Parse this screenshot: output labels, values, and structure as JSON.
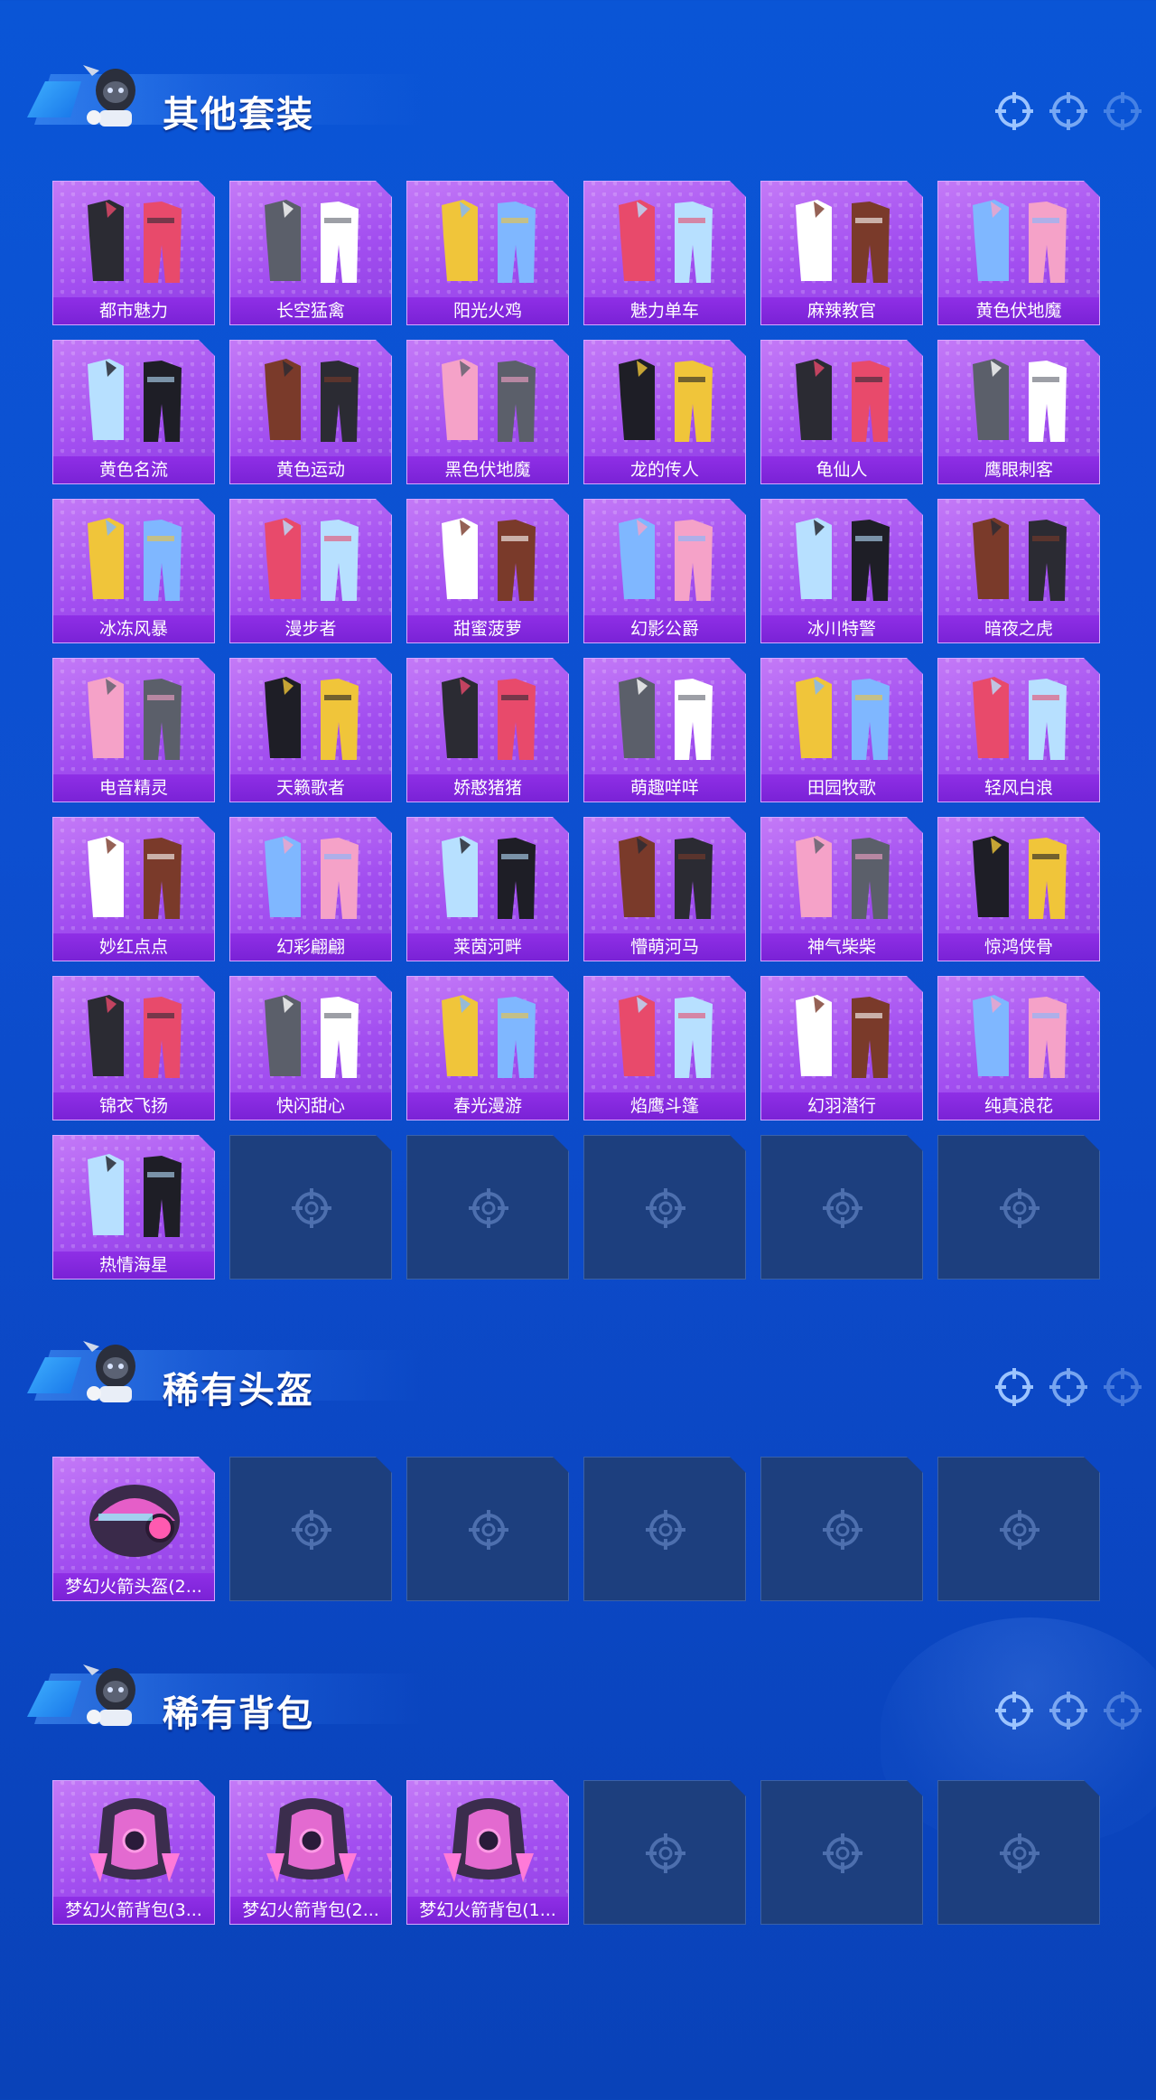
{
  "colors": {
    "bg": "#0a55d6",
    "card_purple": "#a24ef0",
    "label_purple": "#7a22d6",
    "empty_slot": "#1d3f7e"
  },
  "sections": [
    {
      "title": "其他套装",
      "items": [
        {
          "name": "都市魅力",
          "icon": "outfit-icon"
        },
        {
          "name": "长空猛禽",
          "icon": "outfit-icon"
        },
        {
          "name": "阳光火鸡",
          "icon": "outfit-icon"
        },
        {
          "name": "魅力单车",
          "icon": "outfit-icon"
        },
        {
          "name": "麻辣教官",
          "icon": "outfit-icon"
        },
        {
          "name": "黄色伏地魔",
          "icon": "outfit-icon"
        },
        {
          "name": "黄色名流",
          "icon": "outfit-icon"
        },
        {
          "name": "黄色运动",
          "icon": "outfit-icon"
        },
        {
          "name": "黑色伏地魔",
          "icon": "outfit-icon"
        },
        {
          "name": "龙的传人",
          "icon": "outfit-icon"
        },
        {
          "name": "龟仙人",
          "icon": "outfit-icon"
        },
        {
          "name": "鹰眼刺客",
          "icon": "outfit-icon"
        },
        {
          "name": "冰冻风暴",
          "icon": "outfit-icon"
        },
        {
          "name": "漫步者",
          "icon": "outfit-icon"
        },
        {
          "name": "甜蜜菠萝",
          "icon": "outfit-icon"
        },
        {
          "name": "幻影公爵",
          "icon": "outfit-icon"
        },
        {
          "name": "冰川特警",
          "icon": "outfit-icon"
        },
        {
          "name": "暗夜之虎",
          "icon": "outfit-icon"
        },
        {
          "name": "电音精灵",
          "icon": "outfit-icon"
        },
        {
          "name": "天籁歌者",
          "icon": "outfit-icon"
        },
        {
          "name": "娇憨猪猪",
          "icon": "outfit-icon"
        },
        {
          "name": "萌趣咩咩",
          "icon": "outfit-icon"
        },
        {
          "name": "田园牧歌",
          "icon": "outfit-icon"
        },
        {
          "name": "轻风白浪",
          "icon": "outfit-icon"
        },
        {
          "name": "妙红点点",
          "icon": "outfit-icon"
        },
        {
          "name": "幻彩翩翩",
          "icon": "outfit-icon"
        },
        {
          "name": "莱茵河畔",
          "icon": "outfit-icon"
        },
        {
          "name": "懵萌河马",
          "icon": "outfit-icon"
        },
        {
          "name": "神气柴柴",
          "icon": "outfit-icon"
        },
        {
          "name": "惊鸿侠骨",
          "icon": "outfit-icon"
        },
        {
          "name": "锦衣飞扬",
          "icon": "outfit-icon"
        },
        {
          "name": "快闪甜心",
          "icon": "outfit-icon"
        },
        {
          "name": "春光漫游",
          "icon": "outfit-icon"
        },
        {
          "name": "焰鹰斗篷",
          "icon": "outfit-icon"
        },
        {
          "name": "幻羽潜行",
          "icon": "outfit-icon"
        },
        {
          "name": "纯真浪花",
          "icon": "outfit-icon"
        },
        {
          "name": "热情海星",
          "icon": "outfit-icon"
        }
      ],
      "empty_slots": 5
    },
    {
      "title": "稀有头盔",
      "items": [
        {
          "name": "梦幻火箭头盔(2...",
          "icon": "helmet-icon"
        }
      ],
      "empty_slots": 5
    },
    {
      "title": "稀有背包",
      "items": [
        {
          "name": "梦幻火箭背包(3...",
          "icon": "backpack-icon"
        },
        {
          "name": "梦幻火箭背包(2...",
          "icon": "backpack-icon"
        },
        {
          "name": "梦幻火箭背包(1...",
          "icon": "backpack-icon"
        }
      ],
      "empty_slots": 3
    }
  ]
}
